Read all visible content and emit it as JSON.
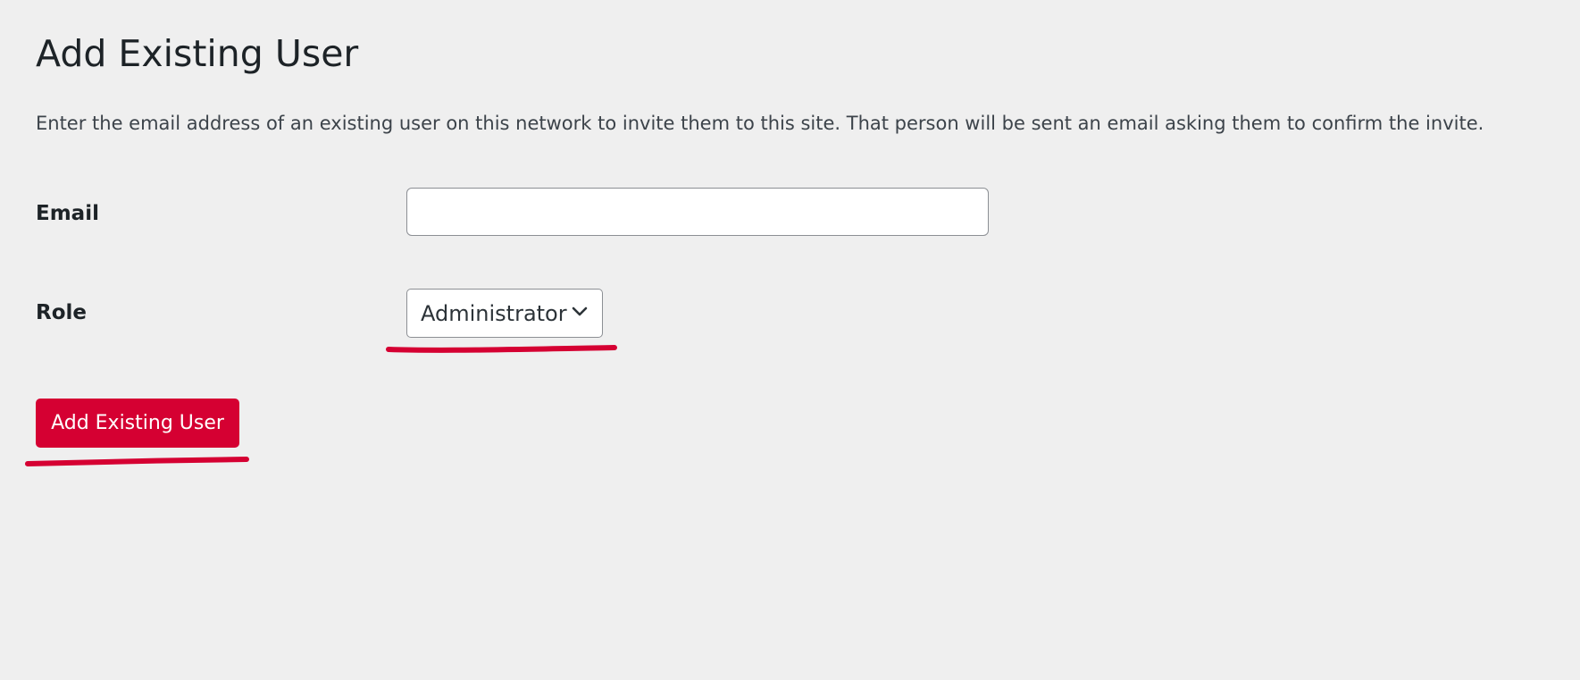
{
  "page": {
    "title": "Add Existing User",
    "description": "Enter the email address of an existing user on this network to invite them to this site. That person will be sent an email asking them to confirm the invite."
  },
  "form": {
    "email_label": "Email",
    "email_value": "",
    "role_label": "Role",
    "role_selected": "Administrator",
    "submit_label": "Add Existing User"
  },
  "colors": {
    "background": "#efefef",
    "primary_button": "#d50032",
    "annotation_underline": "#d50032"
  }
}
